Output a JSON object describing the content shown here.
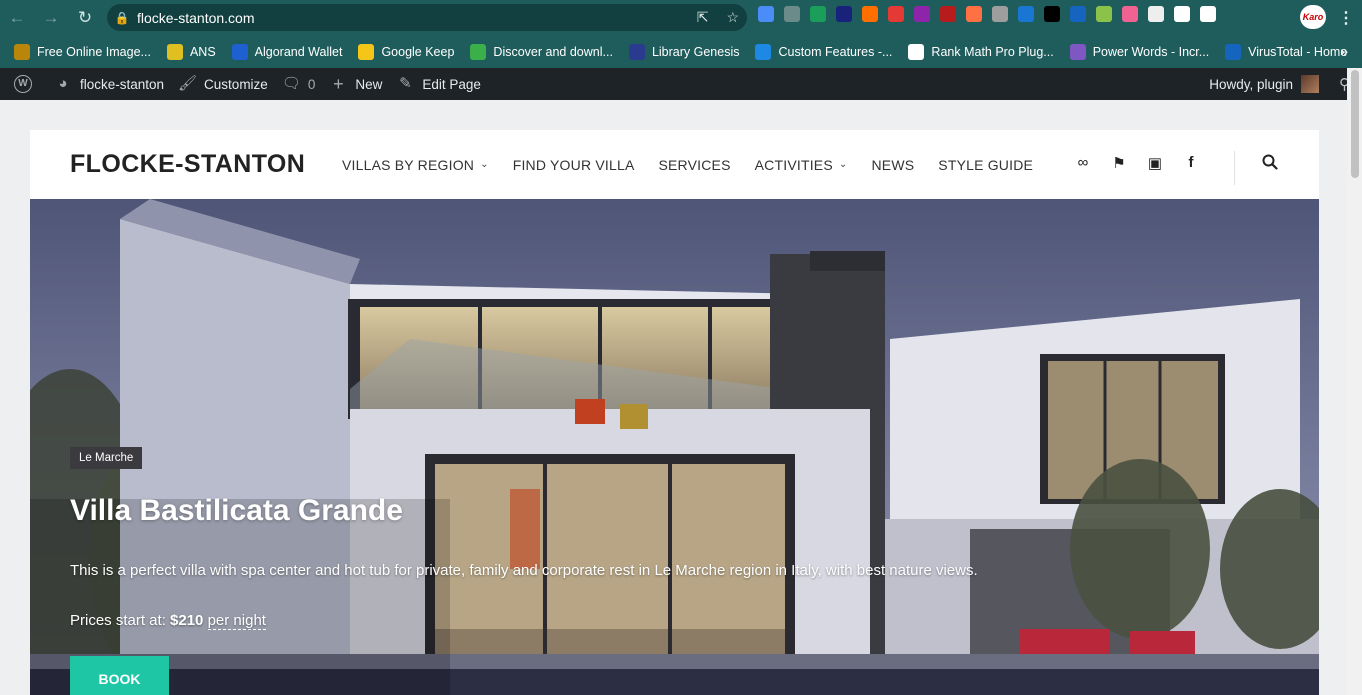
{
  "browser": {
    "url": "flocke-stanton.com",
    "profile_label": "Karo",
    "extension_colors": [
      "#4b8df8",
      "#6b8a8a",
      "#1a9e5a",
      "#18227a",
      "#ff6f00",
      "#e53935",
      "#8e24aa",
      "#b71c1c",
      "#ff7043",
      "#9e9e9e",
      "#1976d2",
      "#000000",
      "#1565c0",
      "#8bc34a",
      "#f06292",
      "#eeeeee",
      "#ffffff",
      "#ffffff"
    ],
    "bookmarks": [
      {
        "label": "Free Online Image...",
        "color": "#b8860b"
      },
      {
        "label": "ANS",
        "color": "#e0c020"
      },
      {
        "label": "Algorand Wallet",
        "color": "#1e60d0"
      },
      {
        "label": "Google Keep",
        "color": "#f5c518"
      },
      {
        "label": "Discover and downl...",
        "color": "#3bb04a"
      },
      {
        "label": "Library Genesis",
        "color": "#2a3b8f"
      },
      {
        "label": "Custom Features -...",
        "color": "#1e88e5"
      },
      {
        "label": "Rank Math Pro Plug...",
        "color": "#ffffff"
      },
      {
        "label": "Power Words - Incr...",
        "color": "#7e57c2"
      },
      {
        "label": "VirusTotal - Home",
        "color": "#1565c0"
      }
    ]
  },
  "adminbar": {
    "site_name": "flocke-stanton",
    "customize": "Customize",
    "comments_count": "0",
    "new": "New",
    "edit_page": "Edit Page",
    "howdy": "Howdy, plugin"
  },
  "site": {
    "logo": "FLOCKE-STANTON",
    "nav": [
      {
        "label": "VILLAS BY REGION",
        "has_dropdown": true
      },
      {
        "label": "FIND YOUR VILLA",
        "has_dropdown": false
      },
      {
        "label": "SERVICES",
        "has_dropdown": false
      },
      {
        "label": "ACTIVITIES",
        "has_dropdown": true
      },
      {
        "label": "NEWS",
        "has_dropdown": false
      },
      {
        "label": "STYLE GUIDE",
        "has_dropdown": false
      }
    ],
    "social_icons": [
      "tripadvisor-icon",
      "foursquare-icon",
      "instagram-icon",
      "facebook-icon"
    ]
  },
  "hero": {
    "badge": "Le Marche",
    "title": "Villa Bastilicata Grande",
    "description": "This is a perfect villa with spa center and hot tub for private, family and corporate rest in Le Marche region in Italy, with best nature views.",
    "price_label": "Prices start at:",
    "price": "$210",
    "price_unit": "per night",
    "button": "BOOK"
  },
  "colors": {
    "browser_chrome": "#1f5c5c",
    "admin_bar": "#1d2327",
    "accent": "#1ec6a6",
    "badge_bg": "#3b3b3f"
  }
}
